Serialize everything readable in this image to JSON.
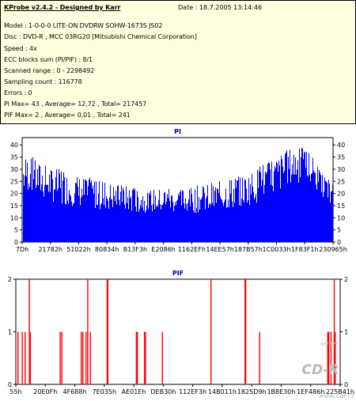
{
  "info": {
    "title": "KProbe v2.4.2 - Designed by Karr",
    "date_label": "Date :",
    "date_value": "18.7.2005 13:14:46",
    "lines": [
      "Model : 1-0-0-0 LITE-ON DVDRW SOHW-1673S JS02",
      "Disc : DVD-R , MCC 03RG20  [Mitsubishi Chemical Corporation]",
      "Speed : 4x",
      "ECC blocks sum (PI/PIF) : 8/1",
      "Scanned range : 0 - 2298492",
      "Sampling count : 116778",
      "Errors : 0",
      "PI Max= 43 , Average= 12,72 , Total= 217457",
      "PIF Max= 2 , Average= 0,01 , Total= 241"
    ]
  },
  "chart_data": [
    {
      "type": "bar",
      "title": "PI",
      "ylim": [
        0,
        43
      ],
      "yticks": [
        "0",
        "5",
        "10",
        "15",
        "20",
        "25",
        "30",
        "35",
        "40"
      ],
      "xticks": [
        "7Dh",
        "21782h",
        "51022h",
        "80834h",
        "B13F3h",
        "E2086h",
        "1162EFh",
        "14EE57h",
        "187B57h",
        "1C0033h",
        "1F83F1h",
        "230965h"
      ],
      "color": "#0000ff",
      "envelope": {
        "x": [
          0.0,
          0.02,
          0.05,
          0.1,
          0.15,
          0.2,
          0.25,
          0.3,
          0.35,
          0.4,
          0.45,
          0.5,
          0.55,
          0.6,
          0.65,
          0.7,
          0.75,
          0.8,
          0.85,
          0.88,
          0.9,
          0.92,
          0.95,
          0.97,
          1.0
        ],
        "max": [
          34,
          37,
          33,
          31,
          28,
          27,
          26,
          24,
          23,
          22,
          22,
          22,
          23,
          24,
          26,
          27,
          30,
          34,
          38,
          40,
          39,
          37,
          33,
          28,
          24
        ],
        "min": [
          22,
          20,
          18,
          16,
          15,
          14,
          13,
          13,
          12,
          12,
          12,
          12,
          12,
          12,
          13,
          14,
          16,
          18,
          22,
          24,
          24,
          22,
          20,
          17,
          15
        ]
      }
    },
    {
      "type": "bar",
      "title": "PIF",
      "ylim": [
        0,
        2
      ],
      "yticks": [
        "0",
        "1",
        "2"
      ],
      "xticks": [
        "55h",
        "20E0Fh",
        "4F688h",
        "7E035h",
        "AE01Eh",
        "DEB30h",
        "112EF3h",
        "14B011h",
        "1825D9h",
        "1B8E30h",
        "1EF486h",
        "225B41h"
      ],
      "color": "#ff0000",
      "spikes": [
        {
          "x": 0.005,
          "v": 1
        },
        {
          "x": 0.018,
          "v": 1
        },
        {
          "x": 0.027,
          "v": 1
        },
        {
          "x": 0.04,
          "v": 2
        },
        {
          "x": 0.043,
          "v": 1
        },
        {
          "x": 0.135,
          "v": 1
        },
        {
          "x": 0.14,
          "v": 1
        },
        {
          "x": 0.2,
          "v": 1
        },
        {
          "x": 0.205,
          "v": 1
        },
        {
          "x": 0.215,
          "v": 1
        },
        {
          "x": 0.22,
          "v": 2
        },
        {
          "x": 0.228,
          "v": 1
        },
        {
          "x": 0.28,
          "v": 2
        },
        {
          "x": 0.282,
          "v": 2
        },
        {
          "x": 0.37,
          "v": 1
        },
        {
          "x": 0.373,
          "v": 1
        },
        {
          "x": 0.395,
          "v": 1
        },
        {
          "x": 0.398,
          "v": 1
        },
        {
          "x": 0.45,
          "v": 1
        },
        {
          "x": 0.6,
          "v": 2
        },
        {
          "x": 0.705,
          "v": 2
        },
        {
          "x": 0.707,
          "v": 2
        },
        {
          "x": 0.75,
          "v": 1
        },
        {
          "x": 0.96,
          "v": 1
        },
        {
          "x": 0.963,
          "v": 1
        },
        {
          "x": 0.97,
          "v": 1
        },
        {
          "x": 0.98,
          "v": 2
        },
        {
          "x": 0.983,
          "v": 1
        }
      ]
    }
  ],
  "watermark": {
    "main": "CD-R",
    "sub": "server",
    "site": "www.cdr.cz"
  },
  "colors": {
    "info_bg": "#ffffe0",
    "pi_title": "#0000aa",
    "pif_title": "#0000aa"
  }
}
